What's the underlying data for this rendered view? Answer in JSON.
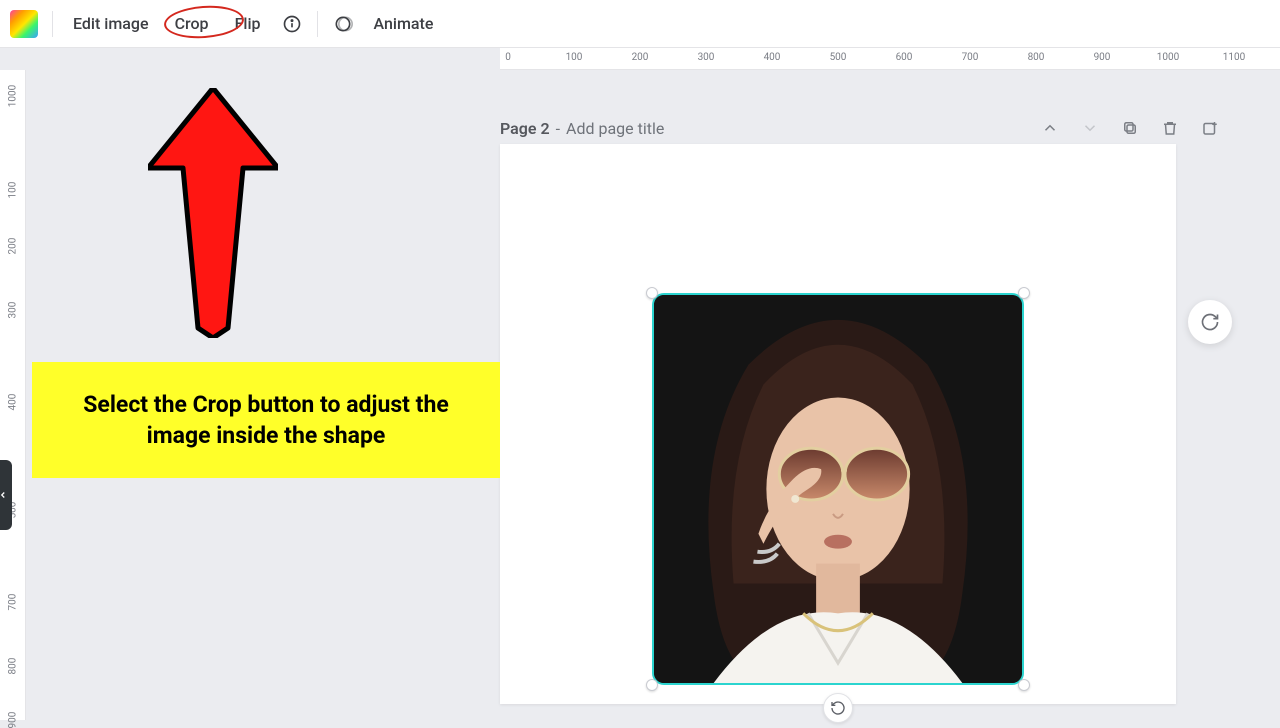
{
  "toolbar": {
    "edit_image": "Edit image",
    "crop": "Crop",
    "flip": "Flip",
    "animate": "Animate"
  },
  "ruler_h": [
    "0",
    "100",
    "200",
    "300",
    "400",
    "500",
    "600",
    "700",
    "800",
    "900",
    "1000",
    "1100"
  ],
  "ruler_v": [
    "1000",
    "100",
    "200",
    "300",
    "400",
    "500",
    "700",
    "800",
    "900"
  ],
  "page": {
    "label": "Page 2",
    "sep": " - ",
    "placeholder": "Add page title"
  },
  "callout": "Select the Crop button to adjust the image inside the shape"
}
